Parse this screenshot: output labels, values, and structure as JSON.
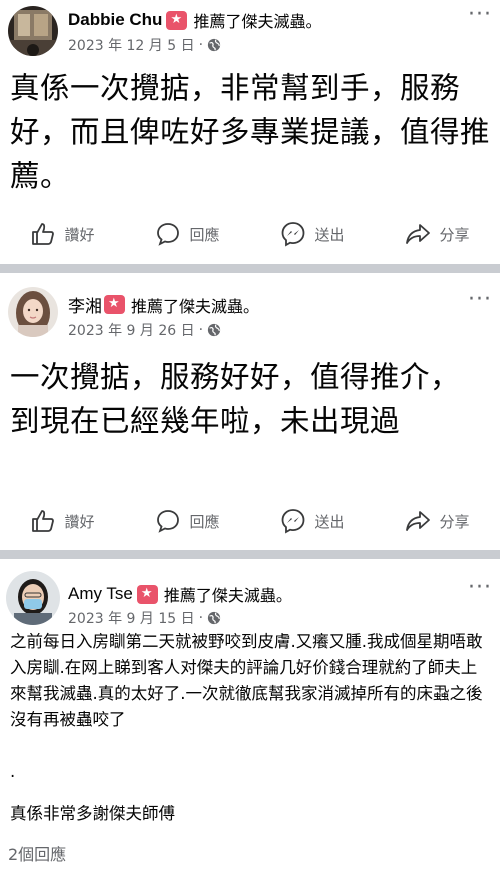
{
  "posts": [
    {
      "author": "Dabbie Chu",
      "recommend_text": "推薦了傑夫滅蟲。",
      "date": "2023 年 12 月 5 日",
      "dot": "·",
      "more": "···",
      "body": "真係一次攪掂，非常幫到手，服務好，而且俾咗好多專業提議，值得推薦。",
      "actions": {
        "like": "讚好",
        "comment": "回應",
        "send": "送出",
        "share": "分享"
      }
    },
    {
      "author": "李湘",
      "recommend_text": "推薦了傑夫滅蟲。",
      "date": "2023 年 9 月 26 日",
      "dot": "·",
      "more": "···",
      "body": "一次攪掂，服務好好，值得推介，到現在已經幾年啦，未出現過",
      "actions": {
        "like": "讚好",
        "comment": "回應",
        "send": "送出",
        "share": "分享"
      }
    },
    {
      "author": "Amy Tse",
      "recommend_text": "推薦了傑夫滅蟲。",
      "date": "2023 年 9 月 15 日",
      "dot": "·",
      "more": "···",
      "body_p1": "之前每日入房瞓第二天就被野咬到皮膚.又癢又腫.我成個星期唔敢入房瞓.在网上睇到客人对傑夫的評論几好价錢合理就約了師夫上來幫我滅蟲.真的太好了.一次就徹底幫我家消滅掉所有的床蝨之後沒有再被蟲咬了",
      "body_p2": ".",
      "body_p3": "真係非常多謝傑夫師傅",
      "comments": "2個回應"
    }
  ]
}
